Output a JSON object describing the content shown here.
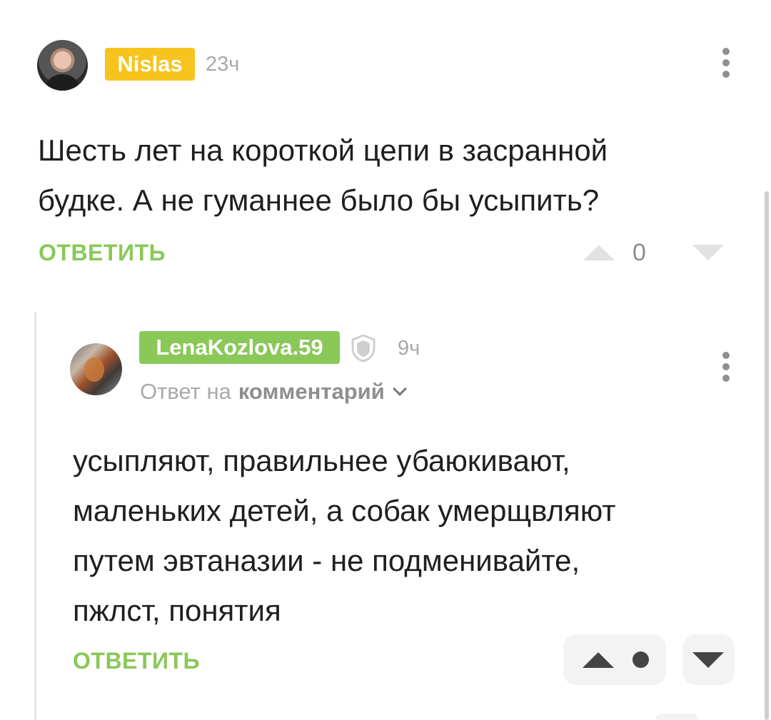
{
  "comments": [
    {
      "username": "Nislas",
      "time": "23ч",
      "text_lines": [
        "Шесть лет на короткой цепи в засранной",
        "будке. А не гуманнее было бы усыпить?"
      ],
      "reply_label": "ОТВЕТИТЬ",
      "score": "0",
      "badge_color": "#f7c31c"
    },
    {
      "username": "LenaKozlova.59",
      "time": "9ч",
      "reply_to_prefix": "Ответ на",
      "reply_to_target": "комментарий",
      "text_lines": [
        "усыпляют, правильнее убаюкивают,",
        "маленьких детей, а собак умерщвляют",
        "путем эвтаназии - не подменивайте,",
        "пжлст, понятия"
      ],
      "reply_label": "ОТВЕТИТЬ",
      "badge_color": "#8ac858"
    }
  ],
  "icons": [
    "more-vertical-icon",
    "vote-up-icon",
    "vote-down-icon",
    "shield-icon",
    "chevron-down-icon"
  ],
  "colors": {
    "accent_green": "#8ac858",
    "accent_yellow": "#f7c31c",
    "muted": "#a9a9a9"
  }
}
